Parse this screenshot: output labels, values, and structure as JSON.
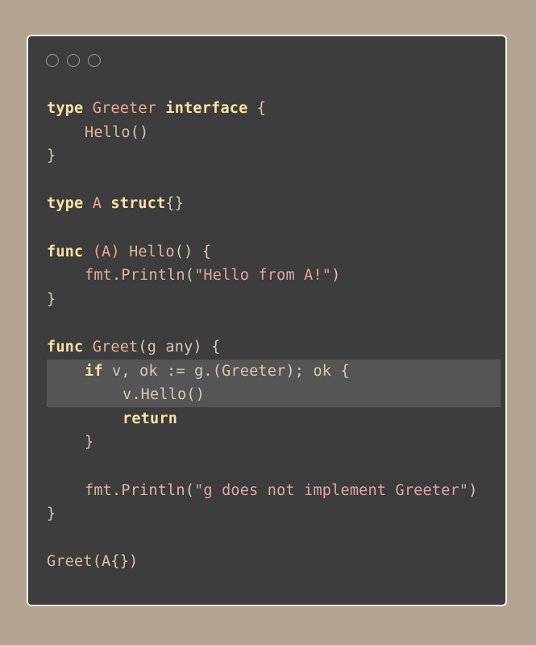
{
  "window": {
    "traffic_lights": [
      "circle-button-1",
      "circle-button-2",
      "circle-button-3"
    ]
  },
  "code": {
    "l1": {
      "kw1": "type",
      "name": "Greeter",
      "kw2": "interface",
      "rest": " {"
    },
    "l2": {
      "method": "Hello",
      "rest": "()"
    },
    "l3": {
      "text": "}"
    },
    "l5": {
      "kw1": "type",
      "name": "A",
      "kw2": "struct",
      "rest": "{}"
    },
    "l7": {
      "kw1": "func",
      "recv": "(A) ",
      "name": "Hello",
      "rest": "() {"
    },
    "l8": {
      "pkg": "fmt",
      "dot": ".",
      "fn": "Println",
      "open": "(",
      "str": "\"Hello from A!\"",
      "close": ")"
    },
    "l9": {
      "text": "}"
    },
    "l11": {
      "kw1": "func",
      "name": "Greet",
      "rest": "(g any) {"
    },
    "l12": {
      "kw1": "if",
      "rest": " v, ok := g.(Greeter); ok {"
    },
    "l13": {
      "text": "v.Hello()"
    },
    "l14": {
      "kw1": "return"
    },
    "l15": {
      "text": "}"
    },
    "l17": {
      "pkg": "fmt",
      "dot": ".",
      "fn": "Println",
      "open": "(",
      "str": "\"g does not implement Greeter\"",
      "close": ")"
    },
    "l18": {
      "text": "}"
    },
    "l20": {
      "name": "Greet",
      "rest": "(A{})"
    }
  },
  "colors": {
    "background": "#b4a493",
    "editor": "#3d3d3d",
    "keyword": "#f7e3a6",
    "type_name": "#e9a991",
    "string": "#e0a5a5",
    "highlight": "#555555"
  }
}
